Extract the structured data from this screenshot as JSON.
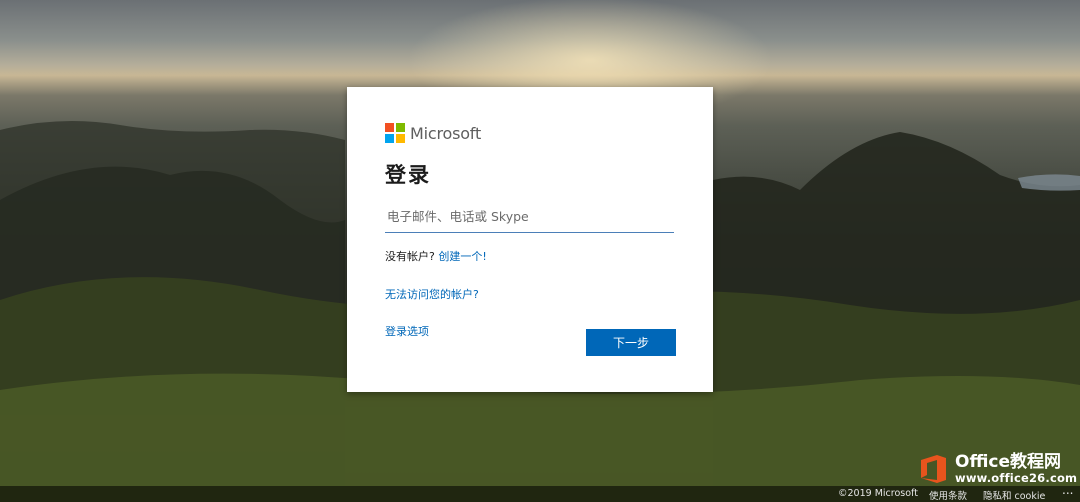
{
  "brand": {
    "name": "Microsoft",
    "logo_colors": [
      "#f25022",
      "#7fba00",
      "#00a4ef",
      "#ffb900"
    ]
  },
  "signin": {
    "title": "登录",
    "email_placeholder": "电子邮件、电话或 Skype",
    "email_value": "",
    "no_account_text": "没有帐户?",
    "create_link": "创建一个!",
    "cant_access_link": "无法访问您的帐户?",
    "options_link": "登录选项",
    "next_button": "下一步",
    "accent_color": "#0067b8"
  },
  "footer": {
    "copyright": "©2019 Microsoft",
    "terms": "使用条款",
    "privacy": "隐私和 cookie",
    "more": "..."
  },
  "watermark": {
    "title": "Office教程网",
    "url": "www.office26.com",
    "icon": "office-logo-icon",
    "color": "#e8541d"
  }
}
